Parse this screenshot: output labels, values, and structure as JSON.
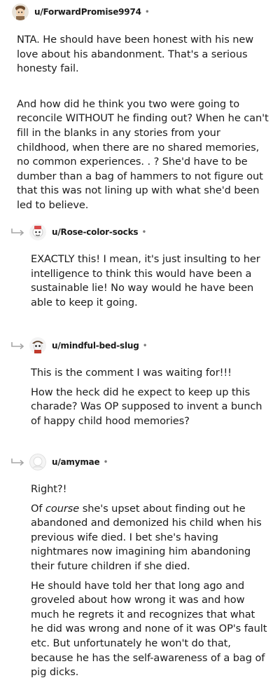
{
  "comments": [
    {
      "username": "u/ForwardPromise9974",
      "dot": "•",
      "paragraphs": [
        "NTA. He should have been honest with his new love about his abandonment. That's a serious honesty fail.",
        "And how did he think you two were going to reconcile WITHOUT he finding out? When he can't fill in the blanks in any stories from your childhood, when there are no shared memories, no common experiences. . ? She'd have to be dumber than a bag of hammers to not figure out that this was not lining up with what she'd been led to believe."
      ]
    },
    {
      "username": "u/Rose-color-socks",
      "dot": "•",
      "paragraphs": [
        "EXACTLY this! I mean, it's just insulting to her intelligence to think this would have been a sustainable lie! No way would he have been able to keep it going."
      ]
    },
    {
      "username": "u/mindful-bed-slug",
      "dot": "•",
      "paragraphs": [
        "This is the comment I was waiting for!!!",
        "How the heck did he expect to keep up this charade? Was OP supposed to invent a bunch of happy child hood memories?"
      ]
    },
    {
      "username": "u/amymae",
      "dot": "•",
      "paragraphs": [
        "Right?!",
        {
          "prefix": "Of ",
          "em": "course",
          "suffix": " she's upset about finding out he abandoned and demonized his child when his previous wife died. I bet she's having nightmares now imagining him abandoning their future children if she died."
        },
        "He should have told her that long ago and groveled about how wrong it was and how much he regrets it and recognizes that what he did was wrong and none of it was OP's fault etc. But unfortunately he won't do that, because he has the self-awareness of a bag of pig dicks."
      ]
    }
  ],
  "icons": {
    "reply": "reply-arrow-icon",
    "avatar": "avatar-icon"
  },
  "colors": {
    "text": "#1c1c1c",
    "muted": "#7c7c7c",
    "reply_arrow": "#a5a5a5"
  }
}
